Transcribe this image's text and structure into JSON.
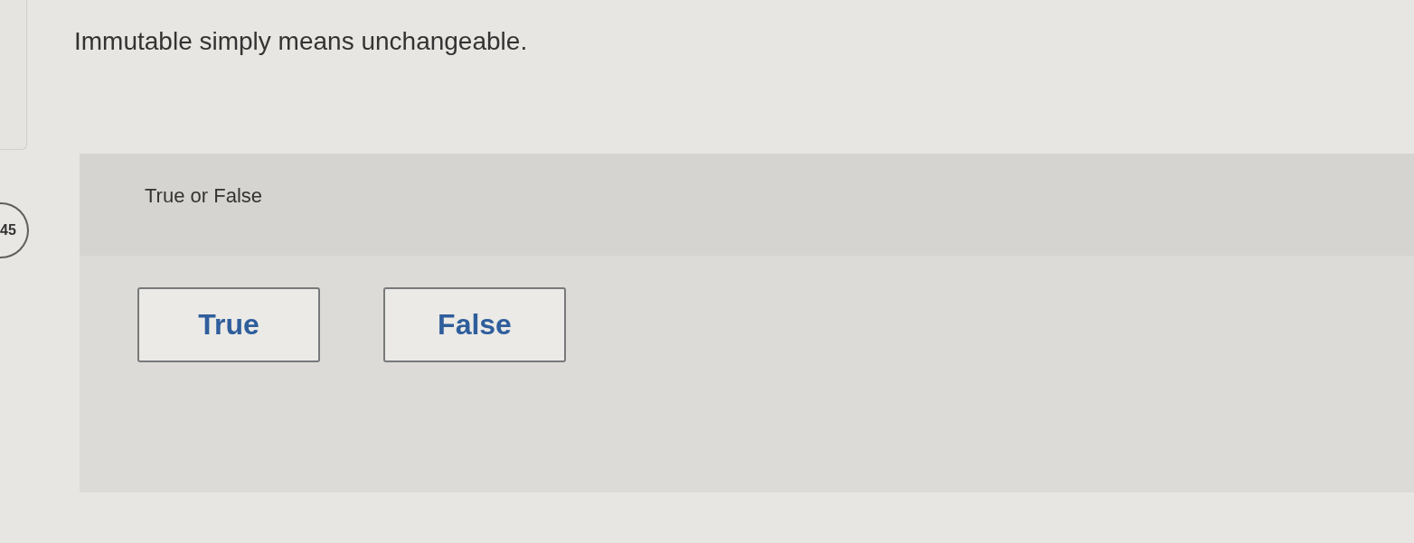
{
  "question": {
    "number": "45",
    "text": "Immutable simply means unchangeable."
  },
  "answer_panel": {
    "instruction": "True or False",
    "choices": [
      {
        "label": "True",
        "selected": false
      },
      {
        "label": "False",
        "selected": false
      }
    ]
  }
}
